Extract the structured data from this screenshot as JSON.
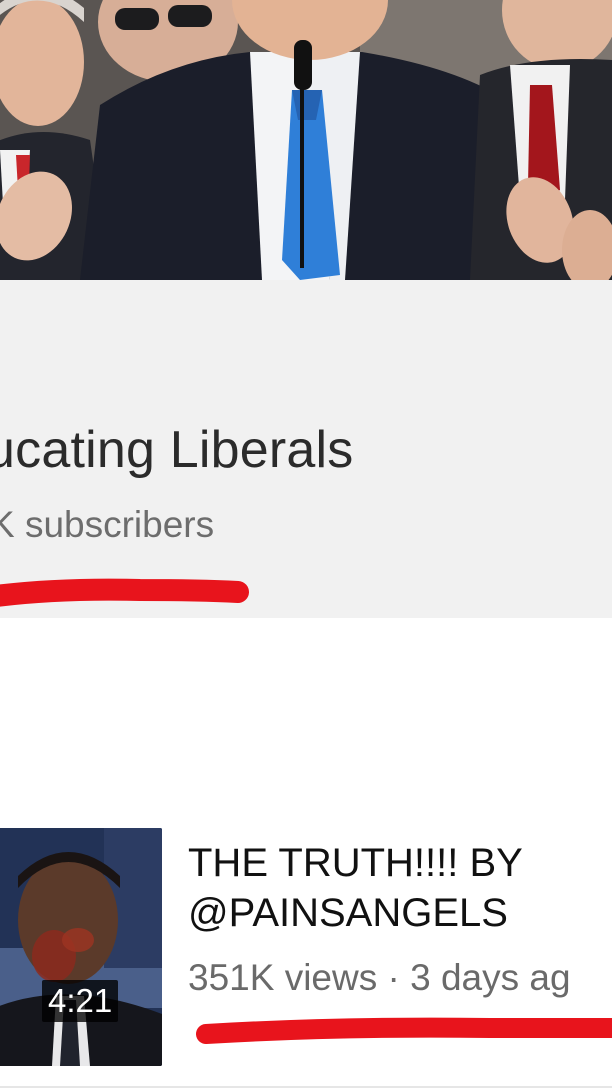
{
  "channel": {
    "name": "ucating Liberals",
    "subscribers": "K subscribers"
  },
  "videos": [
    {
      "title": "THE TRUTH!!!! BY\n@PAINSANGELS",
      "meta": "351K views · 3 days ag",
      "duration": "4:21"
    }
  ],
  "colors": {
    "header_bg": "#f1f1f1",
    "page_bg": "#ffffff",
    "annotation_red": "#e8141c",
    "title_text": "#2b2b2b",
    "subtext": "#6d6d6d",
    "duration_badge_bg": "#000000"
  }
}
